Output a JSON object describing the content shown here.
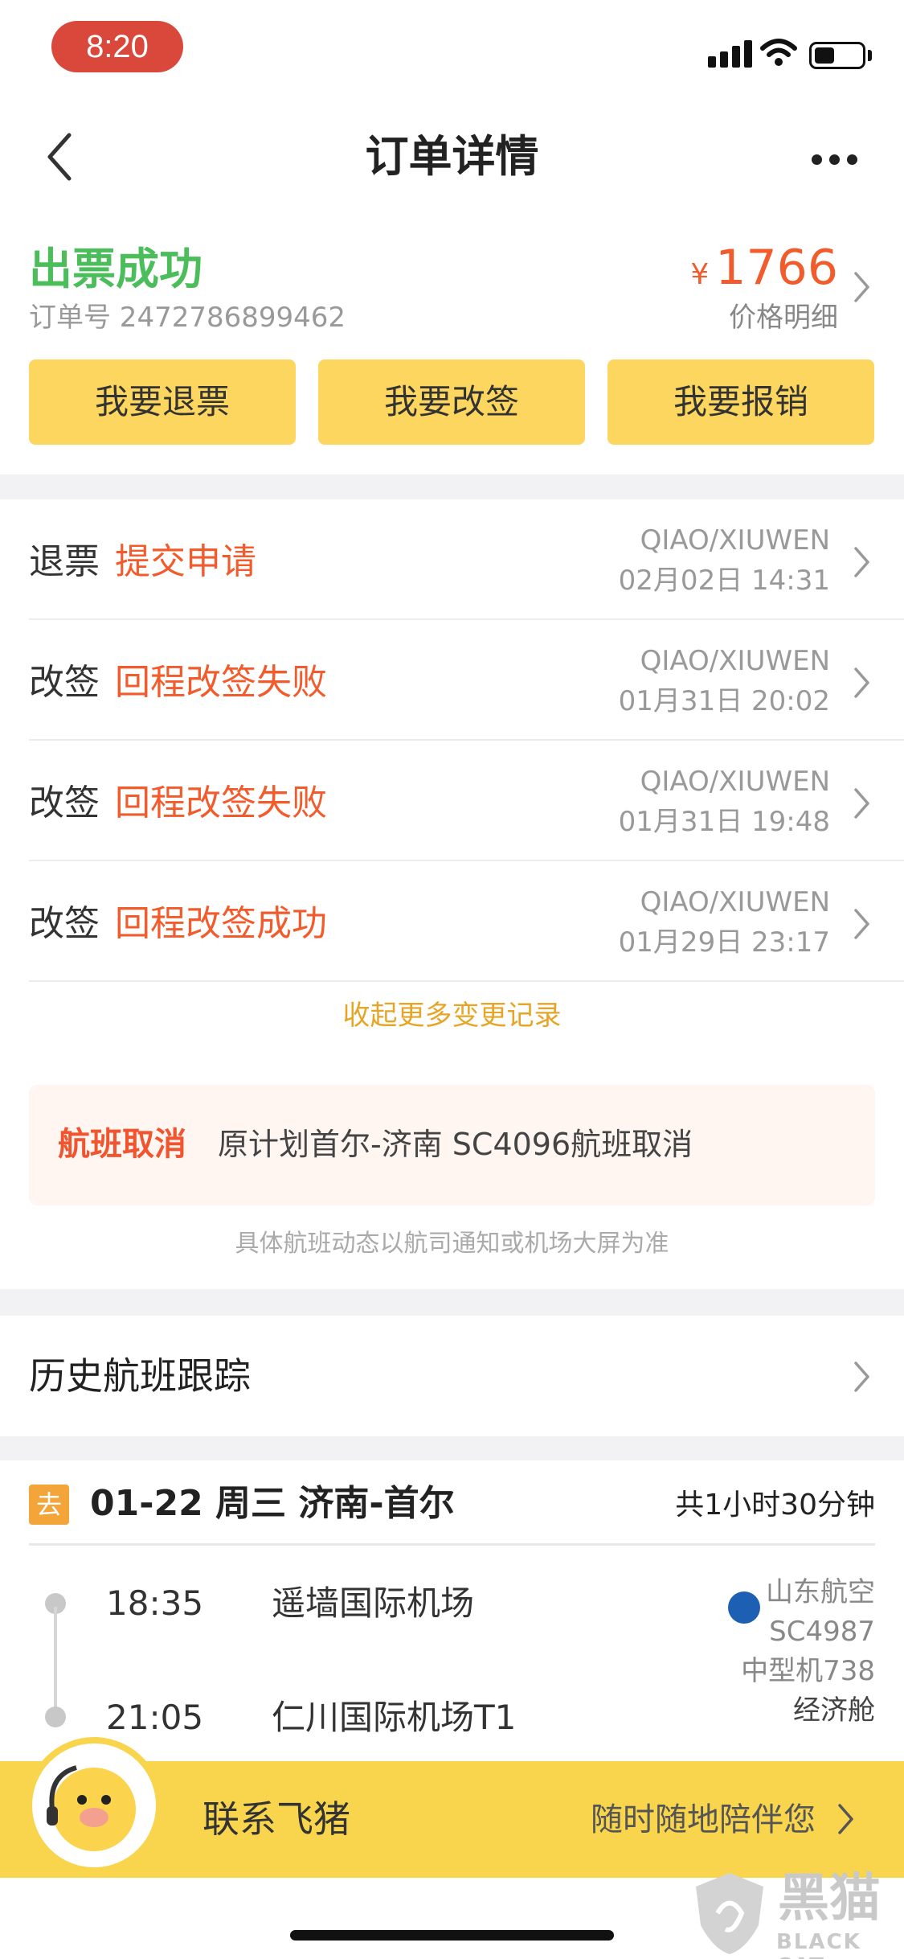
{
  "status_bar": {
    "time": "8:20"
  },
  "nav": {
    "title": "订单详情"
  },
  "order": {
    "status": "出票成功",
    "order_number": "订单号 2472786899462",
    "currency": "¥",
    "price": "1766",
    "price_detail": "价格明细",
    "buttons": [
      "我要退票",
      "我要改签",
      "我要报销"
    ]
  },
  "records": [
    {
      "kind": "退票",
      "desc": "提交申请",
      "passenger": "QIAO/XIUWEN",
      "time": "02月02日 14:31"
    },
    {
      "kind": "改签",
      "desc": "回程改签失败",
      "passenger": "QIAO/XIUWEN",
      "time": "01月31日 20:02"
    },
    {
      "kind": "改签",
      "desc": "回程改签失败",
      "passenger": "QIAO/XIUWEN",
      "time": "01月31日 19:48"
    },
    {
      "kind": "改签",
      "desc": "回程改签成功",
      "passenger": "QIAO/XIUWEN",
      "time": "01月29日 23:17"
    }
  ],
  "collapse_link": "收起更多变更记录",
  "notice": {
    "tag": "航班取消",
    "text": "原计划首尔-济南 SC4096航班取消"
  },
  "footnote": "具体航班动态以航司通知或机场大屏为准",
  "history": {
    "label": "历史航班跟踪"
  },
  "flight": {
    "tag": "去",
    "route": "01-22 周三 济南-首尔",
    "duration": "共1小时30分钟",
    "depart_time": "18:35",
    "depart_airport": "遥墙国际机场",
    "arrive_time": "21:05",
    "arrive_airport": "仁川国际机场T1",
    "airline": "山东航空",
    "flight_no": "SC4987",
    "aircraft": "中型机738",
    "cabin": "经济舱"
  },
  "contact": {
    "label": "联系飞猪",
    "subtitle": "随时随地陪伴您"
  },
  "watermark": {
    "cn": "黑猫",
    "en": "BLACK CAT"
  },
  "colors": {
    "accent": "#f25b2c",
    "success": "#4cbd5b",
    "button": "#fcd65e",
    "link": "#e6a526"
  }
}
